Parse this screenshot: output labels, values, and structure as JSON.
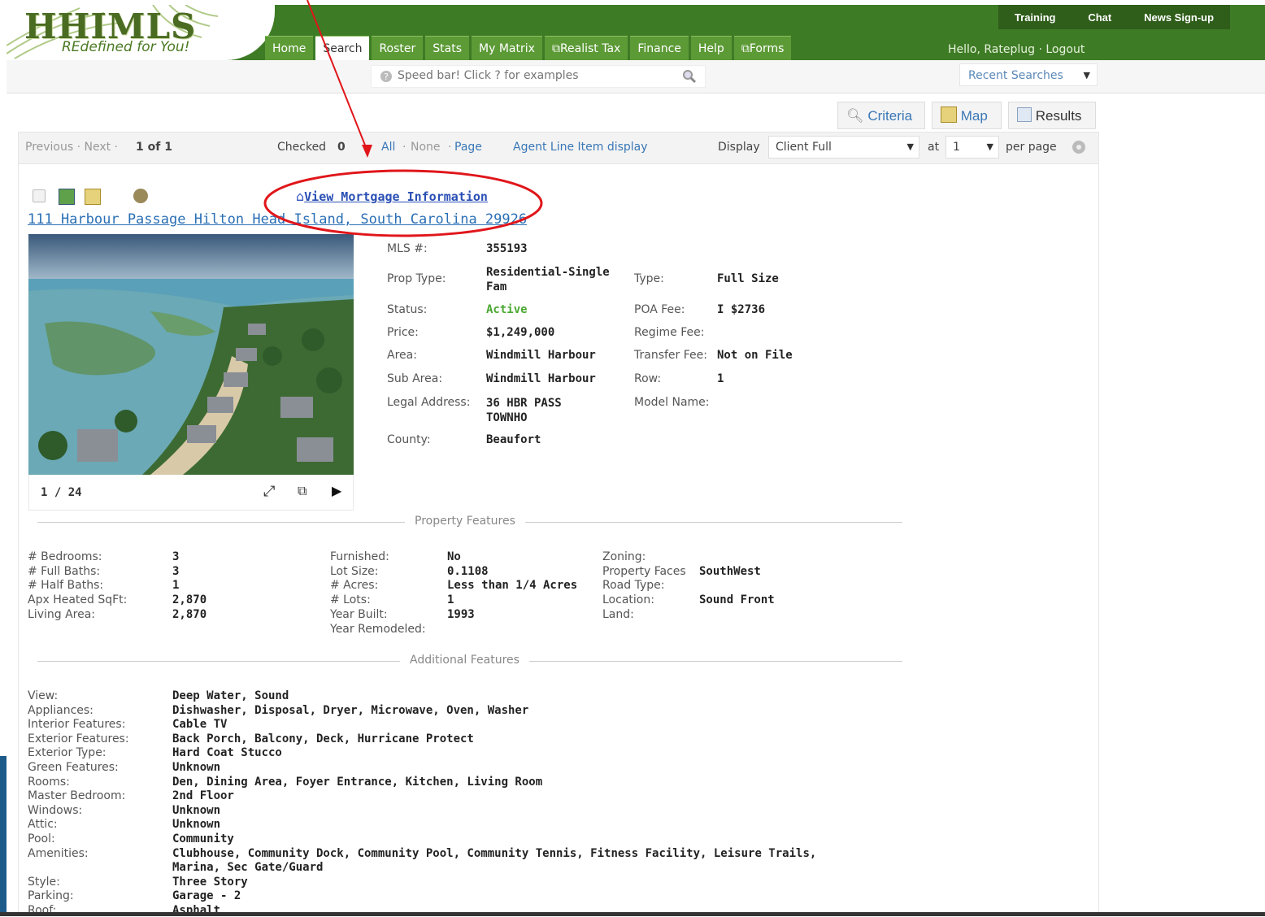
{
  "brand": {
    "logo": "HHIMLS",
    "tagline": "REdefined for You!"
  },
  "top_links": [
    "Training",
    "Chat",
    "News Sign-up"
  ],
  "nav": [
    "Home",
    "Search",
    "Roster",
    "Stats",
    "My Matrix",
    "Realist Tax",
    "Finance",
    "Help",
    "Forms"
  ],
  "user": {
    "greeting": "Hello, Rateplug · Logout"
  },
  "speedbar": {
    "placeholder": "Speed bar! Click ? for examples"
  },
  "recent_searches": "Recent Searches",
  "views": {
    "criteria": "Criteria",
    "map": "Map",
    "results": "Results"
  },
  "results_bar": {
    "prev_next": "Previous · Next ·",
    "count": "1 of 1",
    "checked_label": "Checked",
    "checked_count": "0",
    "select_all": "All",
    "select_none": "None",
    "select_page": "Page",
    "agent_line": "Agent Line Item display",
    "display_label": "Display",
    "display_value": "Client Full",
    "at_label": "at",
    "at_value": "1",
    "per_page": "per page"
  },
  "listing": {
    "mortgage_link": "View Mortgage Information",
    "address": "111 Harbour Passage Hilton Head Island, South Carolina 29926",
    "photo_counter": "1 / 24",
    "details_left": [
      {
        "label": "MLS #:",
        "value": "355193"
      },
      {
        "label": "Prop Type:",
        "value": "Residential-Single Fam"
      },
      {
        "label": "Status:",
        "value": "Active"
      },
      {
        "label": "Price:",
        "value": "$1,249,000"
      },
      {
        "label": "Area:",
        "value": "Windmill Harbour"
      },
      {
        "label": "Sub Area:",
        "value": "Windmill Harbour"
      },
      {
        "label": "Legal Address:",
        "value": "36 HBR PASS TOWNHO"
      },
      {
        "label": "County:",
        "value": "Beaufort"
      }
    ],
    "details_right": [
      {
        "label": "Type:",
        "value": "Full Size"
      },
      {
        "label": "POA Fee:",
        "value": "I $2736"
      },
      {
        "label": "Regime Fee:",
        "value": ""
      },
      {
        "label": "Transfer Fee:",
        "value": "Not on File"
      },
      {
        "label": "Row:",
        "value": "1"
      },
      {
        "label": "Model Name:",
        "value": ""
      }
    ],
    "status_color": "#4aa832"
  },
  "property_features": {
    "title": "Property Features",
    "col1": [
      {
        "label": "# Bedrooms:",
        "value": "3"
      },
      {
        "label": "# Full Baths:",
        "value": "3"
      },
      {
        "label": "# Half Baths:",
        "value": "1"
      },
      {
        "label": "Apx Heated SqFt:",
        "value": "2,870"
      },
      {
        "label": "Living Area:",
        "value": "2,870"
      }
    ],
    "col2": [
      {
        "label": "Furnished:",
        "value": "No"
      },
      {
        "label": "Lot Size:",
        "value": "0.1108"
      },
      {
        "label": "# Acres:",
        "value": "Less than 1/4 Acres"
      },
      {
        "label": "# Lots:",
        "value": "1"
      },
      {
        "label": "Year Built:",
        "value": "1993"
      },
      {
        "label": "Year Remodeled:",
        "value": ""
      }
    ],
    "col3": [
      {
        "label": "Zoning:",
        "value": ""
      },
      {
        "label": "Property Faces",
        "value": "SouthWest"
      },
      {
        "label": "Road Type:",
        "value": ""
      },
      {
        "label": "Location:",
        "value": "Sound Front"
      },
      {
        "label": "Land:",
        "value": ""
      }
    ]
  },
  "additional_features": {
    "title": "Additional Features",
    "rows": [
      {
        "label": "View:",
        "value": "Deep Water, Sound"
      },
      {
        "label": "Appliances:",
        "value": "Dishwasher, Disposal, Dryer, Microwave, Oven, Washer"
      },
      {
        "label": "Interior Features:",
        "value": "Cable TV"
      },
      {
        "label": "Exterior Features:",
        "value": "Back Porch, Balcony, Deck, Hurricane Protect"
      },
      {
        "label": "Exterior Type:",
        "value": "Hard Coat Stucco"
      },
      {
        "label": "Green Features:",
        "value": "Unknown"
      },
      {
        "label": "Rooms:",
        "value": "Den, Dining Area, Foyer Entrance, Kitchen, Living Room"
      },
      {
        "label": "Master Bedroom:",
        "value": "2nd Floor"
      },
      {
        "label": "Windows:",
        "value": "Unknown"
      },
      {
        "label": "Attic:",
        "value": "Unknown"
      },
      {
        "label": "Pool:",
        "value": "Community"
      },
      {
        "label": "Amenities:",
        "value": "Clubhouse, Community Dock, Community Pool, Community Tennis, Fitness Facility, Leisure Trails,"
      },
      {
        "label": "",
        "value": "Marina, Sec Gate/Guard"
      },
      {
        "label": "Style:",
        "value": "Three Story"
      },
      {
        "label": "Parking:",
        "value": "Garage - 2"
      },
      {
        "label": "Roof:",
        "value": "Asphalt"
      }
    ]
  },
  "colors": {
    "header_green": "#3e7b25",
    "link_blue": "#3a77b6",
    "annotation_red": "#e0161b"
  }
}
